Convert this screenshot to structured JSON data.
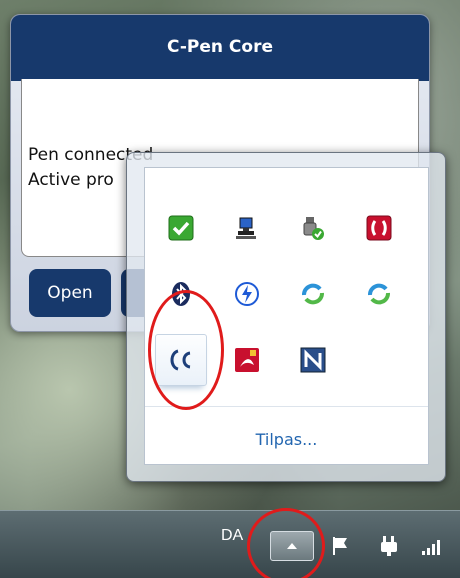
{
  "cpen_window": {
    "title": "C-Pen Core",
    "line1": "Pen connected",
    "line2": "Active pro",
    "open_label": "Open"
  },
  "tray_popup": {
    "customize_label": "Tilpas...",
    "icons": [
      "security-check-icon",
      "network-computer-icon",
      "usb-device-icon",
      "adobe-updater-icon",
      "bluetooth-icon",
      "intel-rapid-storage-icon",
      "sync-icon",
      "sync-icon",
      "cpen-icon",
      "acrobat-icon",
      "nero-icon"
    ]
  },
  "taskbar": {
    "language": "DA",
    "icons": [
      "show-hidden-icons-icon",
      "action-center-flag-icon",
      "power-icon",
      "network-signal-icon"
    ]
  },
  "colors": {
    "title_bar": "#17396c",
    "link": "#2366b0",
    "annotation": "#e01b1b"
  }
}
